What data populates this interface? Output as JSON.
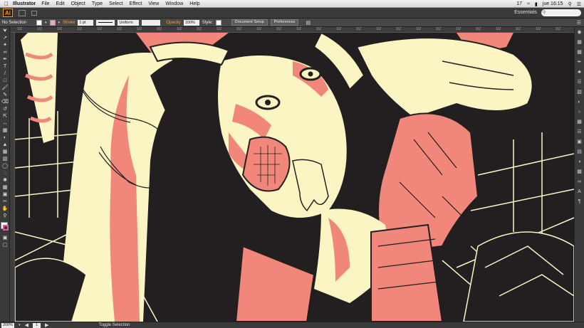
{
  "menubar": {
    "apple": "",
    "app_name": "Illustrator",
    "items": [
      "File",
      "Edit",
      "Object",
      "Type",
      "Select",
      "Effect",
      "View",
      "Window",
      "Help"
    ],
    "status": {
      "ai_badge": "17",
      "time": "jue 16:15"
    }
  },
  "appbar": {
    "logo": "Ai",
    "workspace": "Essentials"
  },
  "control": {
    "selection": "No Selection",
    "stroke_label": "Stroke",
    "stroke_value": "1 pt",
    "profile": "Uniform",
    "opacity_label": "Opacity",
    "opacity_value": "100%",
    "style_label": "Style:",
    "doc_setup": "Document Setup",
    "preferences": "Preferences"
  },
  "ruler": {
    "tick": "1/2"
  },
  "status": {
    "zoom": "200%",
    "page": "1",
    "message": "Toggle Selection"
  },
  "colors": {
    "cream": "#fbf5c3",
    "salmon": "#f0877a",
    "ink": "#231f20",
    "accent": "#f59a23"
  }
}
